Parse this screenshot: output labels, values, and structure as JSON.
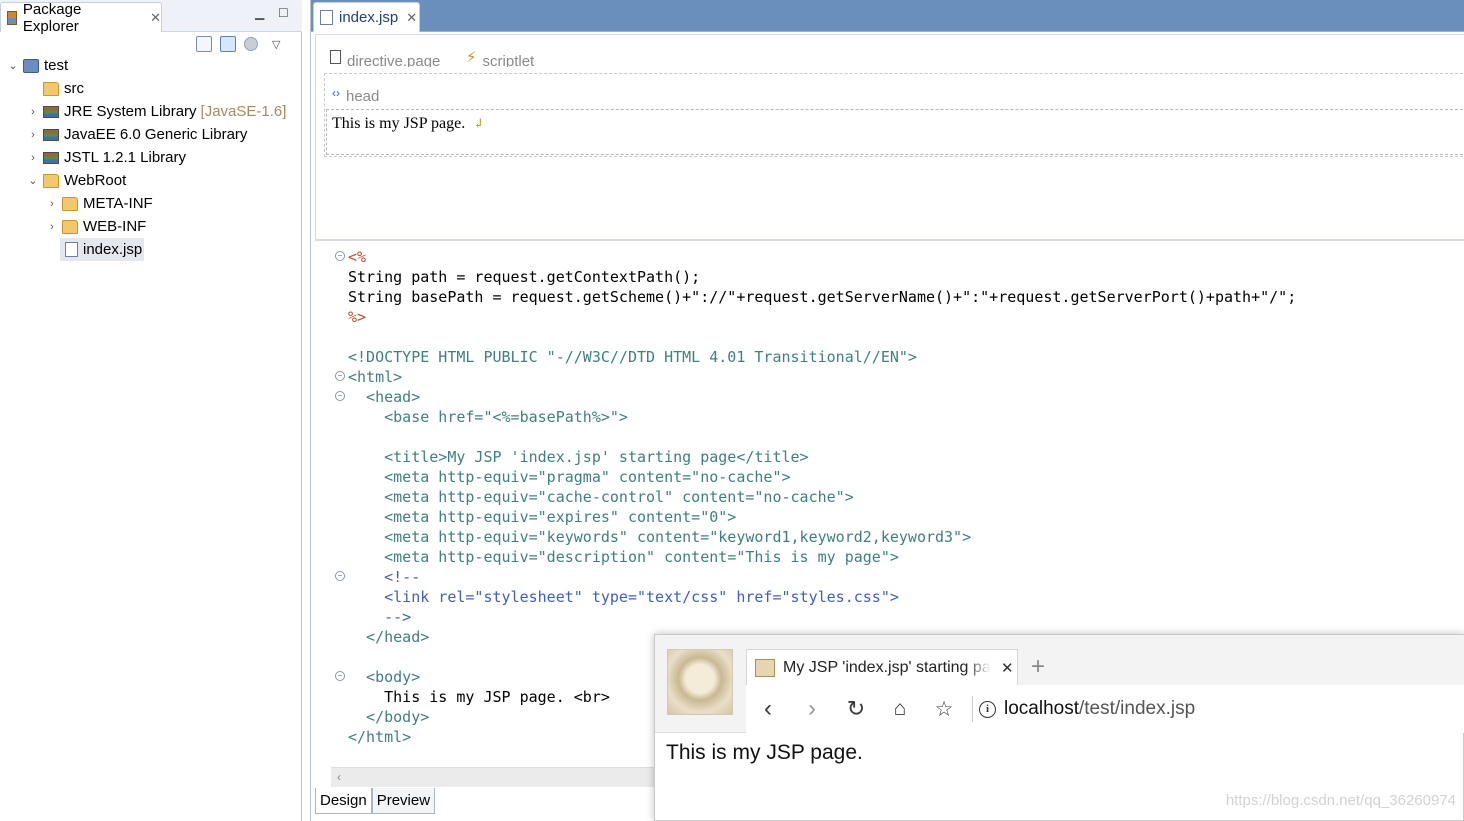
{
  "package_explorer": {
    "tab_title": "Package Explorer",
    "tree": [
      {
        "label": "test",
        "level": 0,
        "icon": "project-icon",
        "expanded": true
      },
      {
        "label": "src",
        "level": 1,
        "icon": "source-folder-icon"
      },
      {
        "label": "JRE System Library",
        "suffix": "[JavaSE-1.6]",
        "level": 1,
        "icon": "library-icon"
      },
      {
        "label": "JavaEE 6.0 Generic Library",
        "level": 1,
        "icon": "library-icon"
      },
      {
        "label": "JSTL 1.2.1 Library",
        "level": 1,
        "icon": "library-icon"
      },
      {
        "label": "WebRoot",
        "level": 1,
        "icon": "folder-icon",
        "expanded": true
      },
      {
        "label": "META-INF",
        "level": 2,
        "icon": "folder-icon"
      },
      {
        "label": "WEB-INF",
        "level": 2,
        "icon": "folder-icon"
      },
      {
        "label": "index.jsp",
        "level": 2,
        "icon": "jsp-file-icon",
        "selected": true
      }
    ]
  },
  "editor": {
    "tab_title": "index.jsp",
    "design": {
      "directive_tag": "directive.page",
      "scriptlet_tag": "scriptlet",
      "head_tag": "head",
      "body_text": "This is my JSP page."
    },
    "source_lines": [
      "<%",
      "String path = request.getContextPath();",
      "String basePath = request.getScheme()+\"://\"+request.getServerName()+\":\"+request.getServerPort()+path+\"/\";",
      "%>",
      "",
      "<!DOCTYPE HTML PUBLIC \"-//W3C//DTD HTML 4.01 Transitional//EN\">",
      "<html>",
      "  <head>",
      "    <base href=\"<%=basePath%>\">",
      "",
      "    <title>My JSP 'index.jsp' starting page</title>",
      "    <meta http-equiv=\"pragma\" content=\"no-cache\">",
      "    <meta http-equiv=\"cache-control\" content=\"no-cache\">",
      "    <meta http-equiv=\"expires\" content=\"0\">",
      "    <meta http-equiv=\"keywords\" content=\"keyword1,keyword2,keyword3\">",
      "    <meta http-equiv=\"description\" content=\"This is my page\">",
      "    <!--",
      "    <link rel=\"stylesheet\" type=\"text/css\" href=\"styles.css\">",
      "    -->",
      "  </head>",
      "",
      "  <body>",
      "    This is my JSP page. <br>",
      "  </body>",
      "</html>"
    ],
    "bottom_tabs": [
      "Design",
      "Preview"
    ]
  },
  "browser": {
    "tab_title": "My JSP 'index.jsp' starting page",
    "url_host": "localhost",
    "url_path": "/test/index.jsp",
    "content_text": "This is my JSP page."
  },
  "watermark": "https://blog.csdn.net/qq_36260974"
}
